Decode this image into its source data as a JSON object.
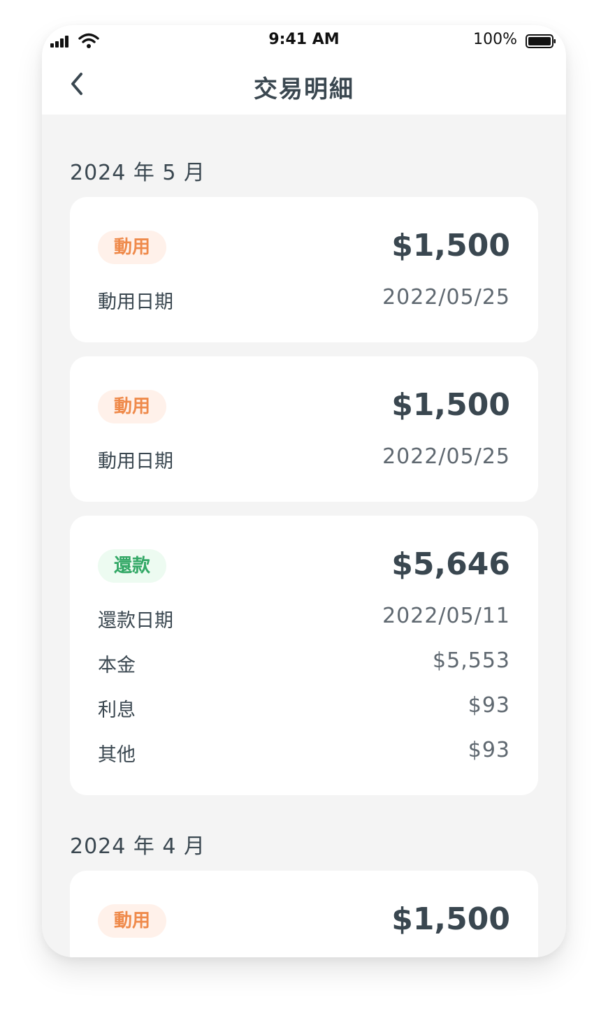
{
  "status_bar": {
    "time": "9:41 AM",
    "battery": "100%"
  },
  "header": {
    "title": "交易明細",
    "back_icon": "chevron-left-icon"
  },
  "colors": {
    "draw_badge_bg": "#fff1ea",
    "draw_badge_text": "#ef8a4b",
    "repay_badge_bg": "#edfbf1",
    "repay_badge_text": "#33a866",
    "text_primary": "#3a4750",
    "background": "#f4f4f4"
  },
  "months": [
    {
      "label": "2024 年 5 月",
      "transactions": [
        {
          "type_label": "動用",
          "amount": "$1,500",
          "rows": [
            {
              "label": "動用日期",
              "value": "2022/05/25"
            }
          ]
        },
        {
          "type_label": "動用",
          "amount": "$1,500",
          "rows": [
            {
              "label": "動用日期",
              "value": "2022/05/25"
            }
          ]
        },
        {
          "type_label": "還款",
          "amount": "$5,646",
          "rows": [
            {
              "label": "還款日期",
              "value": "2022/05/11"
            },
            {
              "label": "本金",
              "value": "$5,553"
            },
            {
              "label": "利息",
              "value": "$93"
            },
            {
              "label": "其他",
              "value": "$93"
            }
          ]
        }
      ]
    },
    {
      "label": "2024 年 4 月",
      "transactions": [
        {
          "type_label": "動用",
          "amount": "$1,500",
          "rows": []
        }
      ]
    }
  ]
}
